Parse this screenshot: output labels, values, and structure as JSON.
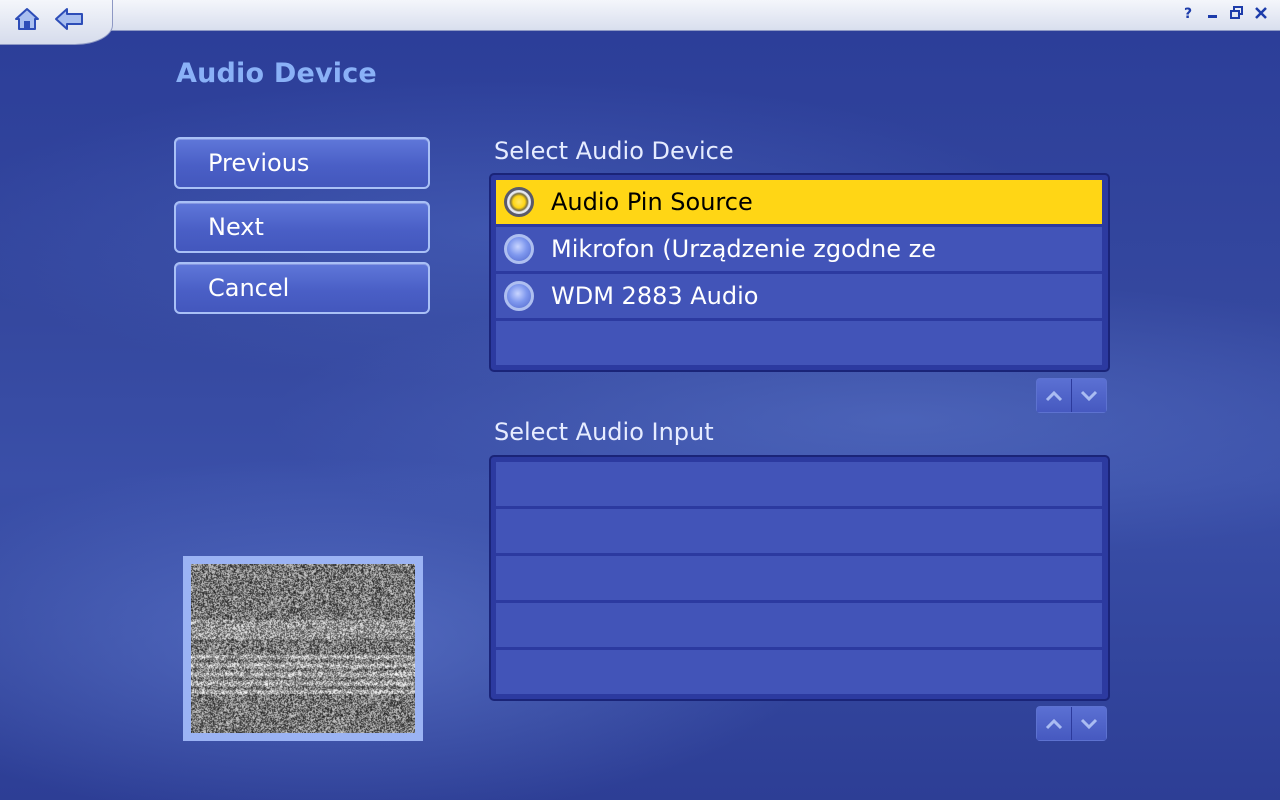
{
  "icons": {
    "home": "home-icon",
    "back": "back-arrow-icon",
    "help": "help-icon",
    "minimize": "minimize-icon",
    "restore": "restore-icon",
    "close": "close-icon",
    "scroll_up": "chevron-up-icon",
    "scroll_down": "chevron-down-icon"
  },
  "page": {
    "title": "Audio Device"
  },
  "nav_buttons": {
    "previous": "Previous",
    "next": "Next",
    "cancel": "Cancel"
  },
  "device_list": {
    "label": "Select Audio Device",
    "selected_index": 0,
    "items": [
      {
        "label": "Audio Pin Source"
      },
      {
        "label": "Mikrofon (Urządzenie zgodne ze"
      },
      {
        "label": "WDM 2883 Audio"
      },
      {
        "label": ""
      }
    ]
  },
  "input_list": {
    "label": "Select Audio Input",
    "items": [
      {
        "label": ""
      },
      {
        "label": ""
      },
      {
        "label": ""
      },
      {
        "label": ""
      },
      {
        "label": ""
      }
    ]
  },
  "colors": {
    "accent_selected": "#ffd615",
    "title": "#8ab1f7",
    "row": "#4254b8"
  }
}
